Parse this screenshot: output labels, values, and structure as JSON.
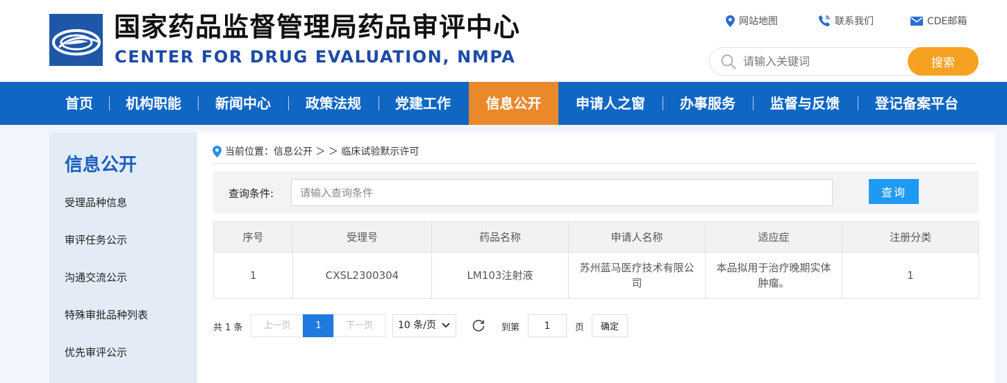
{
  "header": {
    "title_cn": "国家药品监督管理局药品审评中心",
    "title_en": "CENTER FOR DRUG EVALUATION, NMPA",
    "links": [
      {
        "label": "网站地图",
        "icon": "map-pin-icon"
      },
      {
        "label": "联系我们",
        "icon": "phone-icon"
      },
      {
        "label": "CDE邮箱",
        "icon": "mail-icon"
      }
    ],
    "search": {
      "placeholder": "请输入关键词",
      "button": "搜索"
    }
  },
  "nav": {
    "items": [
      "首页",
      "机构职能",
      "新闻中心",
      "政策法规",
      "党建工作",
      "信息公开",
      "申请人之窗",
      "办事服务",
      "监督与反馈",
      "登记备案平台"
    ],
    "active": "信息公开"
  },
  "sidebar": {
    "title": "信息公开",
    "items": [
      "受理品种信息",
      "审评任务公示",
      "沟通交流公示",
      "特殊审批品种列表",
      "优先审评公示"
    ]
  },
  "breadcrumb": {
    "text": "当前位置：信息公开 ＞ ＞ 临床试验默示许可"
  },
  "query": {
    "label": "查询条件:",
    "placeholder": "请输入查询条件",
    "button": "查询"
  },
  "table": {
    "headers": [
      "序号",
      "受理号",
      "药品名称",
      "申请人名称",
      "适应症",
      "注册分类"
    ],
    "rows": [
      [
        "1",
        "CXSL2300304",
        "LM103注射液",
        "苏州蓝马医疗技术有限公司",
        "本品拟用于治疗晚期实体肿瘤。",
        "1"
      ]
    ]
  },
  "pagination": {
    "total": "共 1 条",
    "prev": "上一页",
    "current": "1",
    "next": "下一页",
    "page_size": "10 条/页",
    "goto_label": "到第",
    "goto_value": "1",
    "page_label": "页",
    "confirm": "确定"
  },
  "colors": {
    "nav_bg": "#1066c3",
    "nav_active": "#e9892b",
    "search_button": "#f7a122",
    "query_button": "#1f9af3",
    "page_current": "#1f7be0",
    "title_en": "#1d4aa6"
  }
}
